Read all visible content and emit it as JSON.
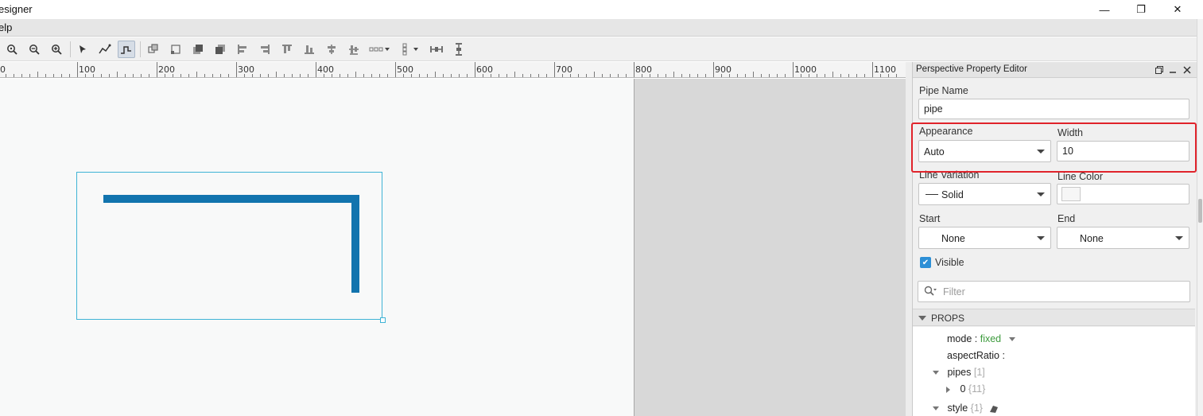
{
  "window": {
    "title": "esigner",
    "controls": {
      "minimize": "—",
      "maximize": "❐",
      "close": "✕"
    }
  },
  "menubar": {
    "items": [
      "elp"
    ]
  },
  "toolbar": {
    "icons": [
      "zoom-actual-icon",
      "zoom-out-icon",
      "zoom-in-icon",
      "select-arrow-icon",
      "pen-tool-icon",
      "pipe-tool-icon",
      "group-icon",
      "ungroup-icon",
      "bring-front-icon",
      "send-back-icon",
      "align-left-icon",
      "align-right-icon",
      "align-top-icon",
      "align-bottom-icon",
      "align-center-h-icon",
      "align-center-v-icon",
      "distribute-h-icon",
      "distribute-v-icon",
      "space-h-icon",
      "space-v-icon"
    ]
  },
  "ruler": {
    "labels": [
      "0",
      "100",
      "200",
      "300",
      "400",
      "500",
      "600",
      "700",
      "800",
      "900",
      "1000",
      "1100"
    ]
  },
  "property_editor": {
    "title": "Perspective Property Editor",
    "pipe_name": {
      "label": "Pipe Name",
      "value": "pipe"
    },
    "appearance": {
      "label": "Appearance",
      "value": "Auto"
    },
    "width": {
      "label": "Width",
      "value": "10"
    },
    "line_variation": {
      "label": "Line Variation",
      "value": "Solid"
    },
    "line_color": {
      "label": "Line Color",
      "value": ""
    },
    "start": {
      "label": "Start",
      "value": "None"
    },
    "end": {
      "label": "End",
      "value": "None"
    },
    "visible": {
      "label": "Visible",
      "checked": true
    },
    "filter": {
      "placeholder": "Filter"
    },
    "props": {
      "title": "PROPS",
      "rows": [
        {
          "key": "mode",
          "colon": ":",
          "value": "fixed"
        },
        {
          "key": "aspectRatio",
          "colon": ":"
        },
        {
          "key": "pipes",
          "count": "[1]"
        },
        {
          "key": "0",
          "count": "{11}"
        },
        {
          "key": "style",
          "count": "{1}"
        }
      ]
    }
  },
  "colors": {
    "pipe": "#1274ae",
    "highlight": "#e0232b",
    "selection": "#3fb3d6",
    "value_green": "#3d9b3d"
  }
}
